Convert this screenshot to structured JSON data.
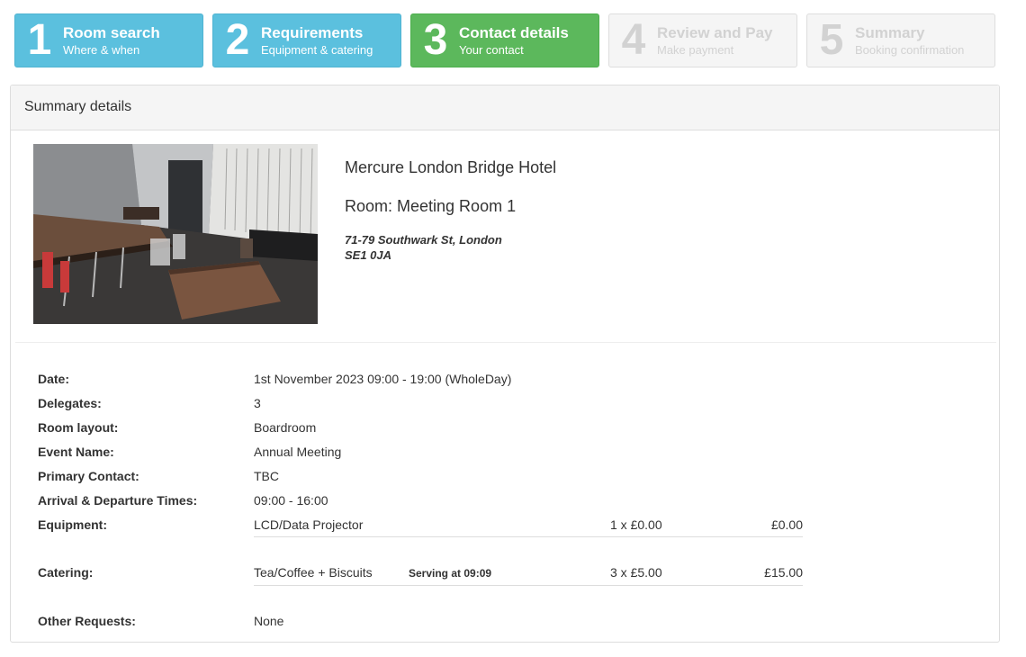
{
  "steps": [
    {
      "num": "1",
      "title": "Room search",
      "sub": "Where & when"
    },
    {
      "num": "2",
      "title": "Requirements",
      "sub": "Equipment & catering"
    },
    {
      "num": "3",
      "title": "Contact details",
      "sub": "Your contact"
    },
    {
      "num": "4",
      "title": "Review and Pay",
      "sub": "Make payment"
    },
    {
      "num": "5",
      "title": "Summary",
      "sub": "Booking confirmation"
    }
  ],
  "summary": {
    "heading": "Summary details",
    "hotel": "Mercure London Bridge Hotel",
    "room": "Room: Meeting Room 1",
    "address_line1": "71-79 Southwark St, London",
    "address_line2": "SE1 0JA"
  },
  "details": {
    "date_label": "Date:",
    "date_value": "1st November 2023 09:00 - 19:00 (WholeDay)",
    "delegates_label": "Delegates:",
    "delegates_value": "3",
    "layout_label": "Room layout:",
    "layout_value": "Boardroom",
    "event_label": "Event Name:",
    "event_value": "Annual Meeting",
    "contact_label": "Primary Contact:",
    "contact_value": "TBC",
    "times_label": "Arrival & Departure Times:",
    "times_value": "09:00 - 16:00",
    "equipment_label": "Equipment:",
    "equipment": {
      "item": "LCD/Data Projector",
      "qty": "1 x £0.00",
      "amount": "£0.00"
    },
    "catering_label": "Catering:",
    "catering": {
      "item": "Tea/Coffee + Biscuits",
      "note": "Serving at 09:09",
      "qty": "3 x £5.00",
      "amount": "£15.00"
    },
    "other_label": "Other Requests:",
    "other_value": "None"
  }
}
